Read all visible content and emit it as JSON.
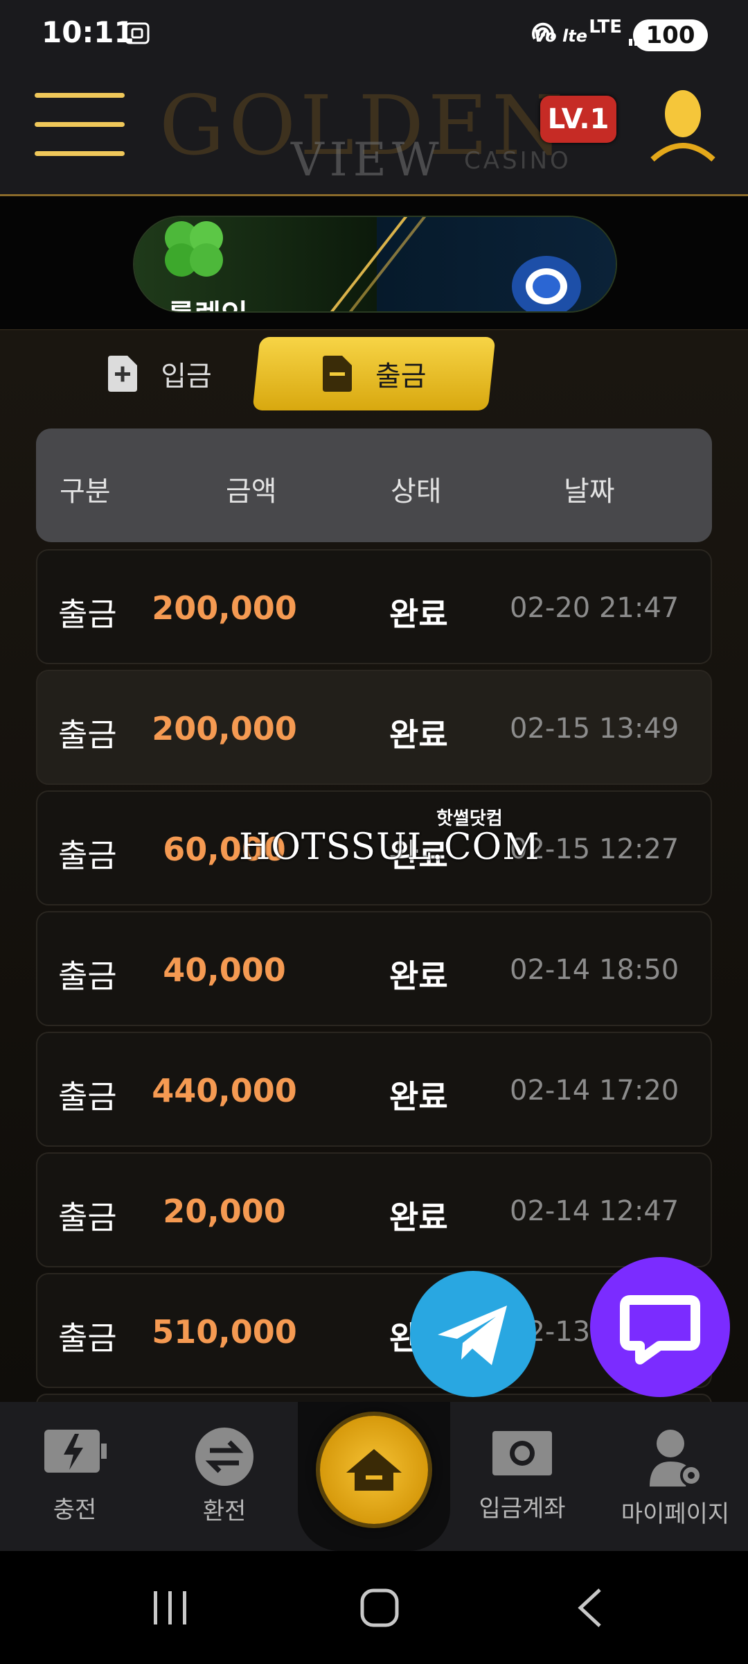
{
  "status_bar": {
    "time": "10:11",
    "volte": "Vo lte",
    "lte": "LTE",
    "battery": "100"
  },
  "header": {
    "logo_text_main": "GOLDEN",
    "logo_text_sub": "VIEW",
    "logo_text_casino": "CASINO",
    "level_badge": "LV.1"
  },
  "banner": {
    "text": "룰렛인"
  },
  "tabs": {
    "deposit_label": "입금",
    "withdraw_label": "출금"
  },
  "table": {
    "headers": [
      "구분",
      "금액",
      "상태",
      "날짜"
    ],
    "rows": [
      {
        "type": "출금",
        "amount": "200,000",
        "status": "완료",
        "date": "02-20 21:47"
      },
      {
        "type": "출금",
        "amount": "200,000",
        "status": "완료",
        "date": "02-15 13:49"
      },
      {
        "type": "출금",
        "amount": "60,000",
        "status": "완료",
        "date": "02-15 12:27"
      },
      {
        "type": "출금",
        "amount": "40,000",
        "status": "완료",
        "date": "02-14 18:50"
      },
      {
        "type": "출금",
        "amount": "440,000",
        "status": "완료",
        "date": "02-14 17:20"
      },
      {
        "type": "출금",
        "amount": "20,000",
        "status": "완료",
        "date": "02-14 12:47"
      },
      {
        "type": "출금",
        "amount": "510,000",
        "status": "완료",
        "date": "02-13"
      }
    ]
  },
  "watermark": {
    "text": "HOTSSUL.COM",
    "sub": "핫썰닷컴"
  },
  "bottom_nav": {
    "charge": "충전",
    "exchange": "환전",
    "deposit_account": "입금계좌",
    "mypage": "마이페이지"
  },
  "colors": {
    "accent_gold": "#f0c85a",
    "amount_orange": "#f59a52",
    "level_red": "#c62b25",
    "telegram_blue": "#29a7e1",
    "chat_purple": "#7b2cff"
  },
  "icons": [
    "menu-icon",
    "user-icon",
    "doc-plus-icon",
    "doc-minus-icon",
    "telegram-icon",
    "chat-icon",
    "charge-icon",
    "exchange-icon",
    "home-icon",
    "bank-account-icon",
    "mypage-icon"
  ]
}
